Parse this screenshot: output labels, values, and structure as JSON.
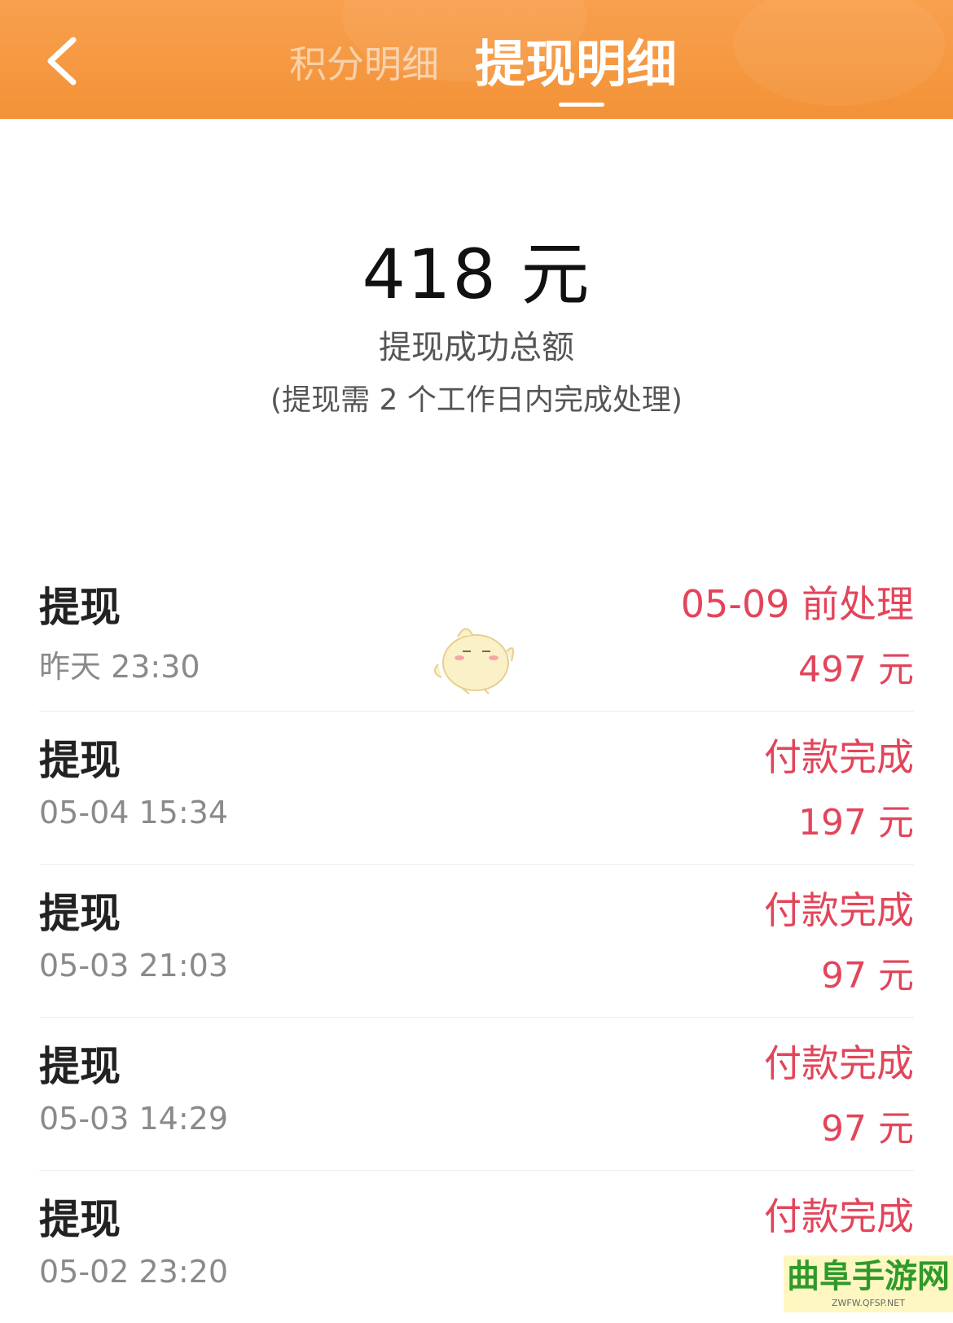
{
  "header": {
    "tabs": [
      {
        "label": "积分明细",
        "active": false
      },
      {
        "label": "提现明细",
        "active": true
      }
    ],
    "back_icon": "chevron-left-icon"
  },
  "summary": {
    "total_amount": "418 元",
    "total_label": "提现成功总额",
    "note": "(提现需 2 个工作日内完成处理)"
  },
  "records": [
    {
      "title": "提现",
      "time": "昨天 23:30",
      "status": "05-09 前处理",
      "amount": "497 元"
    },
    {
      "title": "提现",
      "time": "05-04 15:34",
      "status": "付款完成",
      "amount": "197 元"
    },
    {
      "title": "提现",
      "time": "05-03 21:03",
      "status": "付款完成",
      "amount": "97 元"
    },
    {
      "title": "提现",
      "time": "05-03 14:29",
      "status": "付款完成",
      "amount": "97 元"
    },
    {
      "title": "提现",
      "time": "05-02 23:20",
      "status": "付款完成",
      "amount": ""
    }
  ],
  "watermark": {
    "text": "曲阜手游网",
    "url": "ZWFW.QFSP.NET"
  },
  "colors": {
    "header_orange": "#f39237",
    "status_red": "#e2455a",
    "text_dark": "#222222",
    "text_grey": "#8a8a8a"
  }
}
